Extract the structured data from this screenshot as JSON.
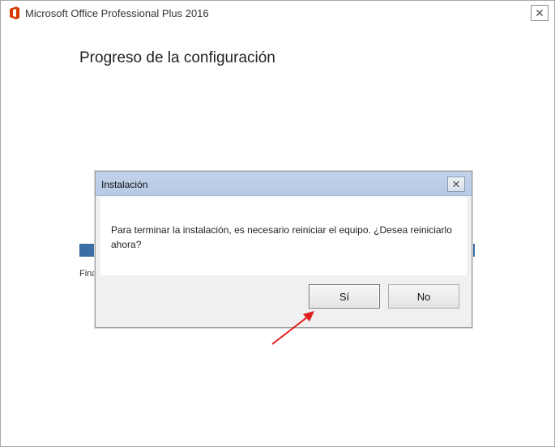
{
  "window": {
    "title": "Microsoft Office Professional Plus 2016",
    "close_glyph": "✕"
  },
  "setup": {
    "heading": "Progreso de la configuración",
    "progress_fraction": 1.0,
    "status_text": "Fina"
  },
  "dialog": {
    "title": "Instalación",
    "close_glyph": "✕",
    "message": "Para terminar la instalación, es necesario reiniciar el equipo. ¿Desea reiniciarlo ahora?",
    "yes_label": "Sí",
    "no_label": "No"
  },
  "colors": {
    "office_red": "#d83b01",
    "progress_blue": "#3a6ea5",
    "arrow_red": "#e0201c"
  }
}
